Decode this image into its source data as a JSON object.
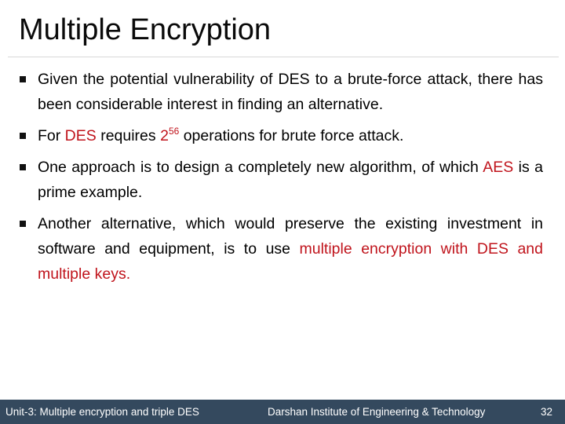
{
  "slide": {
    "title": "Multiple Encryption",
    "accent_color": "#c0141c",
    "bullets": [
      {
        "text": "Given the potential vulnerability of DES to a brute-force attack, there has been considerable interest in finding an alternative."
      },
      {
        "prefix": "For ",
        "highlight_1": "DES",
        "middle": " requires ",
        "base": "2",
        "exponent": "56",
        "suffix": " operations for brute force attack."
      },
      {
        "prefix": "One approach is to design a completely new algorithm, of which ",
        "highlight": "AES",
        "suffix": " is a prime example."
      },
      {
        "prefix": "Another alternative, which would preserve the existing investment in software and equipment, is to use ",
        "highlight": "multiple encryption with DES and multiple keys."
      }
    ]
  },
  "footer": {
    "unit_label": "Unit-3: Multiple encryption and triple DES",
    "institute": "Darshan Institute of Engineering & Technology",
    "page_number": "32",
    "background_color": "#34495e"
  }
}
